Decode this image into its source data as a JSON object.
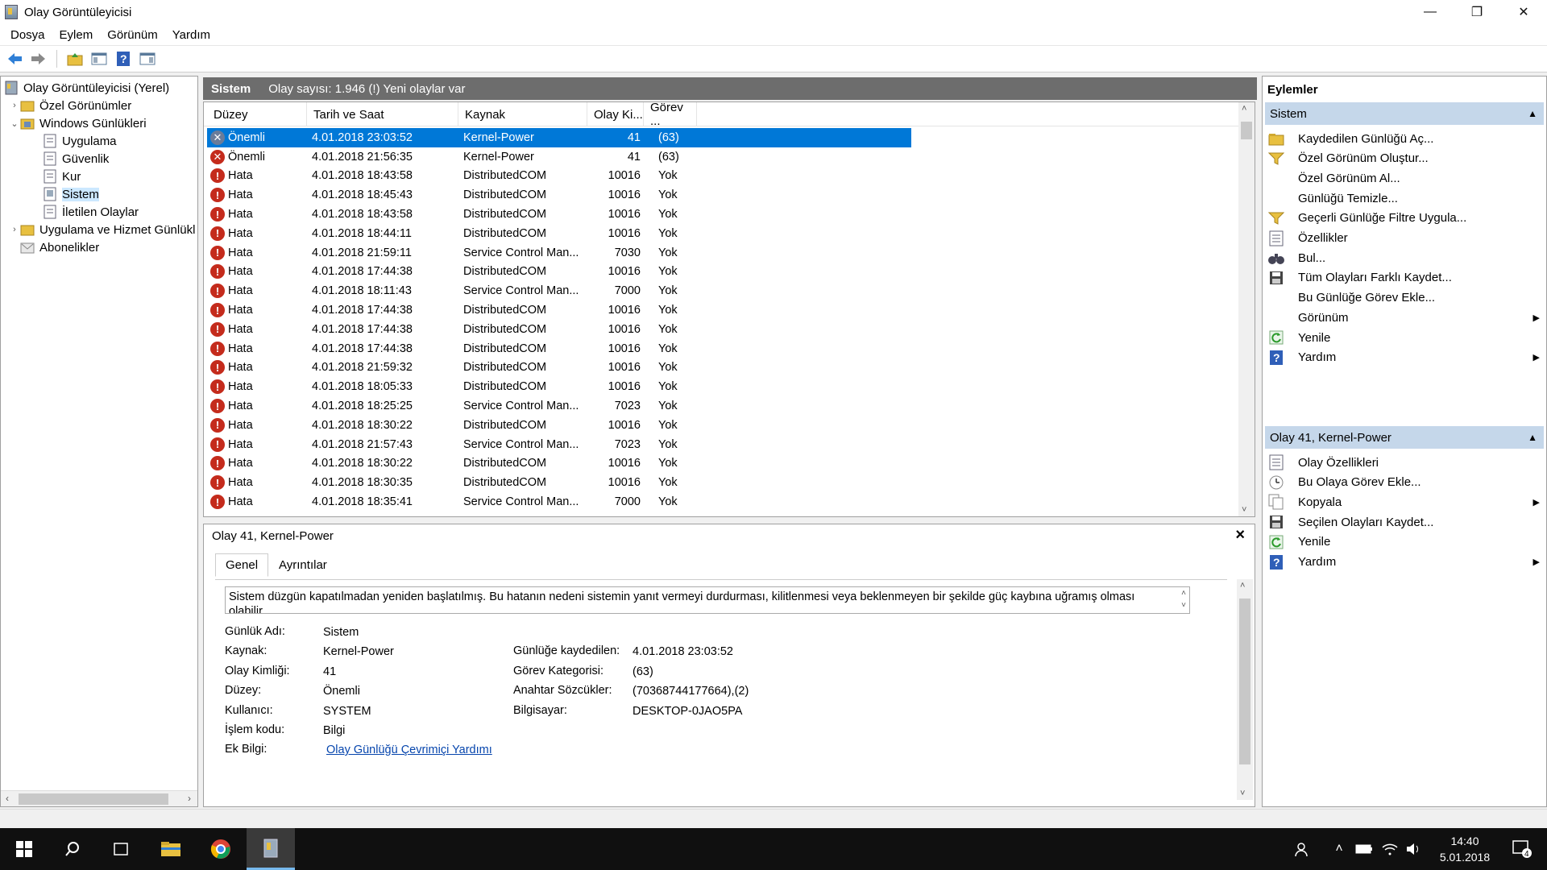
{
  "window": {
    "title": "Olay Görüntüleyicisi",
    "min": "—",
    "max": "❐",
    "close": "✕"
  },
  "menu": [
    "Dosya",
    "Eylem",
    "Görünüm",
    "Yardım"
  ],
  "tree": {
    "root": "Olay Görüntüleyicisi (Yerel)",
    "custom_views": "Özel Görünümler",
    "windows_logs": "Windows Günlükleri",
    "logs": [
      "Uygulama",
      "Güvenlik",
      "Kur",
      "Sistem",
      "İletilen Olaylar"
    ],
    "app_service_logs": "Uygulama ve Hizmet Günlükl",
    "subscriptions": "Abonelikler"
  },
  "header": {
    "name": "Sistem",
    "info": "Olay sayısı: 1.946 (!) Yeni olaylar var"
  },
  "columns": [
    "Düzey",
    "Tarih ve Saat",
    "Kaynak",
    "Olay Ki...",
    "Görev ..."
  ],
  "events": [
    {
      "level": "Önemli",
      "date": "4.01.2018 23:03:52",
      "source": "Kernel-Power",
      "id": "41",
      "task": "(63)",
      "type": "crit"
    },
    {
      "level": "Önemli",
      "date": "4.01.2018 21:56:35",
      "source": "Kernel-Power",
      "id": "41",
      "task": "(63)",
      "type": "crit"
    },
    {
      "level": "Hata",
      "date": "4.01.2018 18:43:58",
      "source": "DistributedCOM",
      "id": "10016",
      "task": "Yok",
      "type": "err"
    },
    {
      "level": "Hata",
      "date": "4.01.2018 18:45:43",
      "source": "DistributedCOM",
      "id": "10016",
      "task": "Yok",
      "type": "err"
    },
    {
      "level": "Hata",
      "date": "4.01.2018 18:43:58",
      "source": "DistributedCOM",
      "id": "10016",
      "task": "Yok",
      "type": "err"
    },
    {
      "level": "Hata",
      "date": "4.01.2018 18:44:11",
      "source": "DistributedCOM",
      "id": "10016",
      "task": "Yok",
      "type": "err"
    },
    {
      "level": "Hata",
      "date": "4.01.2018 21:59:11",
      "source": "Service Control Man...",
      "id": "7030",
      "task": "Yok",
      "type": "err"
    },
    {
      "level": "Hata",
      "date": "4.01.2018 17:44:38",
      "source": "DistributedCOM",
      "id": "10016",
      "task": "Yok",
      "type": "err"
    },
    {
      "level": "Hata",
      "date": "4.01.2018 18:11:43",
      "source": "Service Control Man...",
      "id": "7000",
      "task": "Yok",
      "type": "err"
    },
    {
      "level": "Hata",
      "date": "4.01.2018 17:44:38",
      "source": "DistributedCOM",
      "id": "10016",
      "task": "Yok",
      "type": "err"
    },
    {
      "level": "Hata",
      "date": "4.01.2018 17:44:38",
      "source": "DistributedCOM",
      "id": "10016",
      "task": "Yok",
      "type": "err"
    },
    {
      "level": "Hata",
      "date": "4.01.2018 17:44:38",
      "source": "DistributedCOM",
      "id": "10016",
      "task": "Yok",
      "type": "err"
    },
    {
      "level": "Hata",
      "date": "4.01.2018 21:59:32",
      "source": "DistributedCOM",
      "id": "10016",
      "task": "Yok",
      "type": "err"
    },
    {
      "level": "Hata",
      "date": "4.01.2018 18:05:33",
      "source": "DistributedCOM",
      "id": "10016",
      "task": "Yok",
      "type": "err"
    },
    {
      "level": "Hata",
      "date": "4.01.2018 18:25:25",
      "source": "Service Control Man...",
      "id": "7023",
      "task": "Yok",
      "type": "err"
    },
    {
      "level": "Hata",
      "date": "4.01.2018 18:30:22",
      "source": "DistributedCOM",
      "id": "10016",
      "task": "Yok",
      "type": "err"
    },
    {
      "level": "Hata",
      "date": "4.01.2018 21:57:43",
      "source": "Service Control Man...",
      "id": "7023",
      "task": "Yok",
      "type": "err"
    },
    {
      "level": "Hata",
      "date": "4.01.2018 18:30:22",
      "source": "DistributedCOM",
      "id": "10016",
      "task": "Yok",
      "type": "err"
    },
    {
      "level": "Hata",
      "date": "4.01.2018 18:30:35",
      "source": "DistributedCOM",
      "id": "10016",
      "task": "Yok",
      "type": "err"
    },
    {
      "level": "Hata",
      "date": "4.01.2018 18:35:41",
      "source": "Service Control Man...",
      "id": "7000",
      "task": "Yok",
      "type": "err"
    }
  ],
  "detail": {
    "title": "Olay 41, Kernel-Power",
    "tabs": [
      "Genel",
      "Ayrıntılar"
    ],
    "description": "Sistem düzgün kapatılmadan yeniden başlatılmış. Bu hatanın nedeni sistemin yanıt vermeyi durdurması, kilitlenmesi veya beklenmeyen bir şekilde güç kaybına uğramış olması olabilir.",
    "labels": {
      "log_name": "Günlük Adı:",
      "source": "Kaynak:",
      "event_id": "Olay Kimliği:",
      "level": "Düzey:",
      "user": "Kullanıcı:",
      "opcode": "İşlem kodu:",
      "more_info": "Ek Bilgi:",
      "logged": "Günlüğe kaydedilen:",
      "task_category": "Görev Kategorisi:",
      "keywords": "Anahtar Sözcükler:",
      "computer": "Bilgisayar:"
    },
    "values": {
      "log_name": "Sistem",
      "source": "Kernel-Power",
      "event_id": "41",
      "level": "Önemli",
      "user": "SYSTEM",
      "opcode": "Bilgi",
      "more_info": "Olay Günlüğü Çevrimiçi Yardımı",
      "logged": "4.01.2018 23:03:52",
      "task_category": "(63)",
      "keywords": "(70368744177664),(2)",
      "computer": "DESKTOP-0JAO5PA"
    }
  },
  "actions": {
    "title": "Eylemler",
    "section1": "Sistem",
    "items1": [
      {
        "label": "Kaydedilen Günlüğü Aç...",
        "icon": "open-folder-icon"
      },
      {
        "label": "Özel Görünüm Oluştur...",
        "icon": "filter-icon"
      },
      {
        "label": "Özel Görünüm Al...",
        "icon": ""
      },
      {
        "label": "Günlüğü Temizle...",
        "icon": ""
      },
      {
        "label": "Geçerli Günlüğe Filtre Uygula...",
        "icon": "filter-icon"
      },
      {
        "label": "Özellikler",
        "icon": "properties-icon"
      },
      {
        "label": "Bul...",
        "icon": "binoculars-icon"
      },
      {
        "label": "Tüm Olayları Farklı Kaydet...",
        "icon": "save-icon"
      },
      {
        "label": "Bu Günlüğe Görev Ekle...",
        "icon": ""
      },
      {
        "label": "Görünüm",
        "icon": "",
        "sub": true
      },
      {
        "label": "Yenile",
        "icon": "refresh-icon"
      },
      {
        "label": "Yardım",
        "icon": "help-icon",
        "sub": true
      }
    ],
    "section2": "Olay 41, Kernel-Power",
    "items2": [
      {
        "label": "Olay Özellikleri",
        "icon": "properties-icon"
      },
      {
        "label": "Bu Olaya Görev Ekle...",
        "icon": "task-icon"
      },
      {
        "label": "Kopyala",
        "icon": "copy-icon",
        "sub": true
      },
      {
        "label": "Seçilen Olayları Kaydet...",
        "icon": "save-icon"
      },
      {
        "label": "Yenile",
        "icon": "refresh-icon"
      },
      {
        "label": "Yardım",
        "icon": "help-icon",
        "sub": true
      }
    ]
  },
  "taskbar": {
    "time": "14:40",
    "date": "5.01.2018",
    "notif_count": "4"
  }
}
